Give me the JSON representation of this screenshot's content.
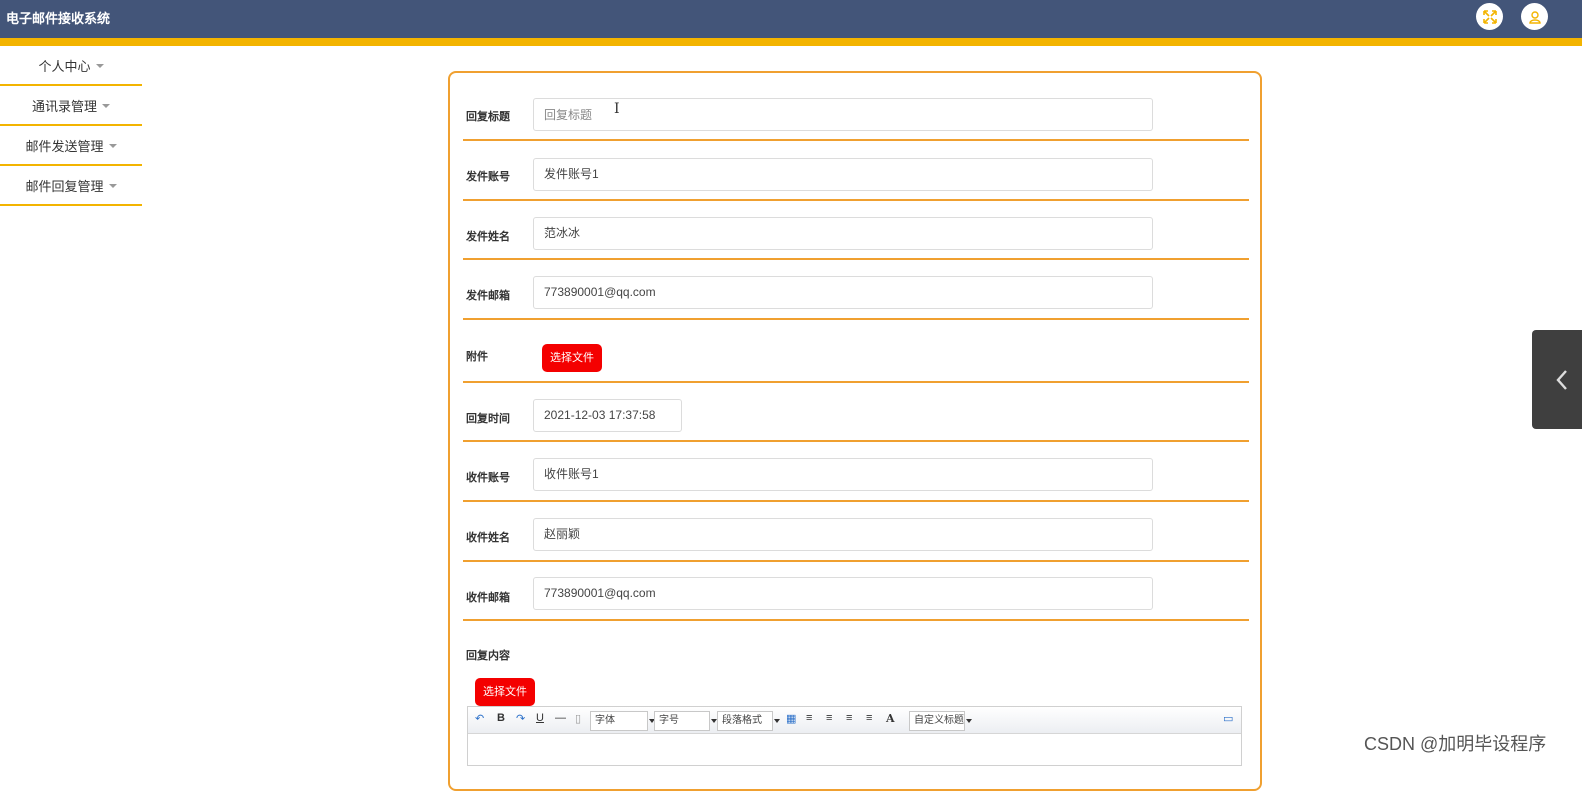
{
  "app": {
    "title": "电子邮件接收系统"
  },
  "topbar": {
    "icons": [
      "fullscreen-icon",
      "user-icon"
    ],
    "accent": "#f3b400",
    "bg": "#435579"
  },
  "sidebar": {
    "items": [
      {
        "label": "个人中心"
      },
      {
        "label": "通讯录管理"
      },
      {
        "label": "邮件发送管理"
      },
      {
        "label": "邮件回复管理"
      }
    ]
  },
  "form": {
    "reply_title": {
      "label": "回复标题",
      "value": "",
      "placeholder": "回复标题"
    },
    "sender_account": {
      "label": "发件账号",
      "value": "发件账号1"
    },
    "sender_name": {
      "label": "发件姓名",
      "value": "范冰冰"
    },
    "sender_email": {
      "label": "发件邮箱",
      "value": "773890001@qq.com"
    },
    "attachment": {
      "label": "附件",
      "button": "选择文件"
    },
    "reply_time": {
      "label": "回复时间",
      "value": "2021-12-03 17:37:58"
    },
    "recipient_account": {
      "label": "收件账号",
      "value": "收件账号1"
    },
    "recipient_name": {
      "label": "收件姓名",
      "value": "赵丽颖"
    },
    "recipient_email": {
      "label": "收件邮箱",
      "value": "773890001@qq.com"
    },
    "reply_content": {
      "label": "回复内容",
      "button": "选择文件"
    }
  },
  "editor": {
    "font_family": "字体",
    "font_size": "字号",
    "paragraph": "段落格式",
    "custom_title": "自定义标题",
    "tools": {
      "bold": "B",
      "underline": "U",
      "hr": "—",
      "font_color": "A"
    }
  },
  "watermark": "CSDN @加明毕设程序"
}
